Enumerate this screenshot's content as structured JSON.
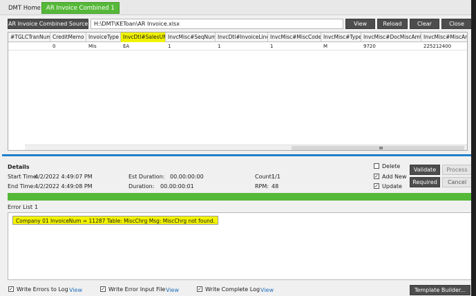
{
  "tabs": {
    "home": "DMT Home",
    "active": "AR Invoice Combined 1"
  },
  "source": {
    "button_label": "AR Invoice Combined Source...",
    "path": "H:\\DMT\\KEToan\\AR Invoice.xlsx"
  },
  "toolbar": {
    "view": "View",
    "reload": "Reload",
    "clear": "Clear",
    "close": "Close"
  },
  "grid": {
    "columns": [
      "#TGLCTranNum",
      "CreditMemo",
      "InvoiceType",
      "InvcDtl#SalesUM",
      "InvcMisc#SeqNum",
      "InvcDtl#InvoiceLine",
      "InvcMisc#MiscCode",
      "InvcMisc#Type",
      "InvcMisc#DocMiscAmt",
      "InvcMisc#MiscAmt"
    ],
    "highlighted_column": "InvcDtl#SalesUM",
    "rows": [
      [
        "",
        "0",
        "Mis",
        "EA",
        "1",
        "1",
        "1",
        "M",
        "9720",
        "225212400"
      ]
    ]
  },
  "details": {
    "heading": "Details",
    "start_time_label": "Start Time:",
    "start_time": "4/2/2022 4:49:07 PM",
    "end_time_label": "End Time:",
    "end_time": "4/2/2022 4:49:08 PM",
    "est_duration_label": "Est Duration:",
    "est_duration": "00.00:00:00",
    "duration_label": "Duration:",
    "duration": "00.00:00:01",
    "count_label": "Count:",
    "count": "1/1",
    "rpm_label": "RPM:",
    "rpm": "48"
  },
  "options": {
    "delete": {
      "label": "Delete",
      "checked": false
    },
    "add_new": {
      "label": "Add New",
      "checked": true
    },
    "update": {
      "label": "Update",
      "checked": true
    }
  },
  "actions": {
    "validate": "Validate",
    "process": "Process",
    "required": "Required",
    "cancel": "Cancel"
  },
  "progress": {
    "value": 1.0,
    "color": "#55b838"
  },
  "error_list": {
    "label": "Error List",
    "count": "1",
    "message": "Company 01 InvoiceNum = 11287   Table: MiscChrg Msg: MiscChrg not found."
  },
  "footer": {
    "write_errors": "Write Errors to Log",
    "write_error_input": "Write Error Input File",
    "write_complete": "Write Complete Log",
    "view": "View",
    "template_builder": "Template Builder..."
  },
  "colors": {
    "accent_green": "#55b838",
    "separator_blue": "#1f7fc9",
    "highlight_yellow": "#f3f300"
  }
}
